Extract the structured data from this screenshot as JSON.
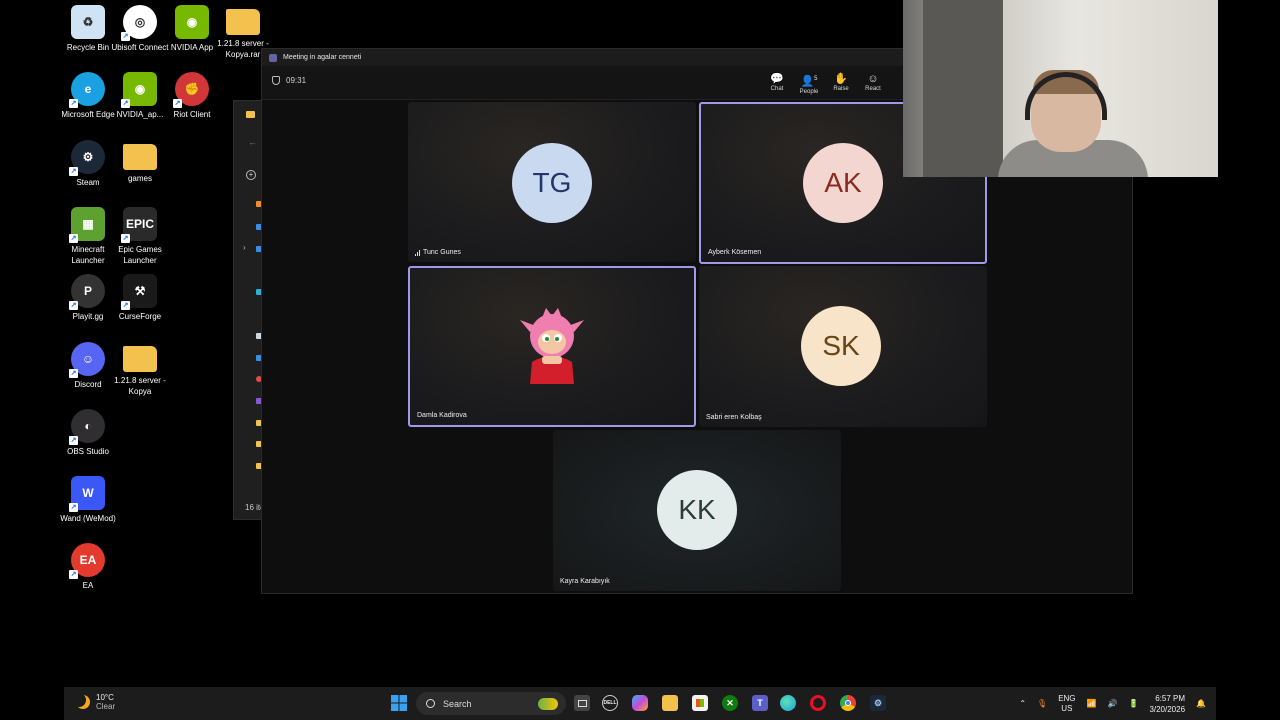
{
  "desktop": {
    "icons": [
      {
        "label": "Recycle Bin",
        "icon": "recycle-bin-icon",
        "color": "#cfe3f4"
      },
      {
        "label": "Ubisoft Connect",
        "icon": "ubisoft-icon",
        "color": "#ffffff"
      },
      {
        "label": "NVIDIA App",
        "icon": "nvidia-icon",
        "color": "#76b900"
      },
      {
        "label": "1.21.8 server - Kopya.rar",
        "icon": "folder-icon",
        "color": "#f2c14e"
      },
      {
        "label": "Microsoft Edge",
        "icon": "edge-icon",
        "color": "#1ba1e2"
      },
      {
        "label": "NVIDIA_ap...",
        "icon": "nvidia-app-icon",
        "color": "#76b900"
      },
      {
        "label": "Riot Client",
        "icon": "riot-icon",
        "color": "#d13639"
      },
      {
        "label": "Steam",
        "icon": "steam-icon",
        "color": "#1b2838"
      },
      {
        "label": "games",
        "icon": "folder-icon",
        "color": "#f2c14e"
      },
      {
        "label": "Minecraft Launcher",
        "icon": "minecraft-icon",
        "color": "#5da130"
      },
      {
        "label": "Epic Games Launcher",
        "icon": "epic-icon",
        "color": "#2a2a2a"
      },
      {
        "label": "Playit.gg",
        "icon": "playit-icon",
        "color": "#333333"
      },
      {
        "label": "CurseForge",
        "icon": "curseforge-icon",
        "color": "#1a1a1a"
      },
      {
        "label": "Discord",
        "icon": "discord-icon",
        "color": "#5865f2"
      },
      {
        "label": "1.21.8 server - Kopya",
        "icon": "folder-icon",
        "color": "#f2c14e"
      },
      {
        "label": "OBS Studio",
        "icon": "obs-icon",
        "color": "#302e31"
      },
      {
        "label": "Wand (WeMod)",
        "icon": "wand-icon",
        "color": "#3b57f5"
      },
      {
        "label": "EA",
        "icon": "ea-icon",
        "color": "#e23b2d"
      }
    ]
  },
  "explorer": {
    "status": "16 ite"
  },
  "teams": {
    "window_title": "Meeting in agalar cenneti",
    "timer": "09:31",
    "toolbar": {
      "chat": "Chat",
      "people": "People",
      "people_count": "5",
      "raise": "Raise",
      "react": "React"
    },
    "participants": [
      {
        "initials": "TG",
        "name": "Tunc Gunes",
        "avatar_bg": "#c9daf0",
        "avatar_fg": "#24356a",
        "active": false,
        "speaking_icon": true
      },
      {
        "initials": "AK",
        "name": "Ayberk Kösemen",
        "avatar_bg": "#f4d6d0",
        "avatar_fg": "#8a2b20",
        "active": true,
        "speaking_icon": false
      },
      {
        "initials": "",
        "name": "Damla Kadirova",
        "avatar_bg": "#3a2a2a",
        "avatar_fg": "#ffffff",
        "active": true,
        "speaking_icon": false
      },
      {
        "initials": "SK",
        "name": "Sabri eren Kolbaş",
        "avatar_bg": "#f8e4c8",
        "avatar_fg": "#6a4316",
        "active": false,
        "speaking_icon": false
      },
      {
        "initials": "KK",
        "name": "Kayra Karabıyık",
        "avatar_bg": "#e3ecea",
        "avatar_fg": "#2b3d3a",
        "active": false,
        "speaking_icon": false
      }
    ]
  },
  "taskbar": {
    "weather_temp": "10°C",
    "weather_cond": "Clear",
    "search_label": "Search",
    "lang_top": "ENG",
    "lang_bottom": "US",
    "time": "6:57 PM",
    "date": "3/20/2026"
  }
}
